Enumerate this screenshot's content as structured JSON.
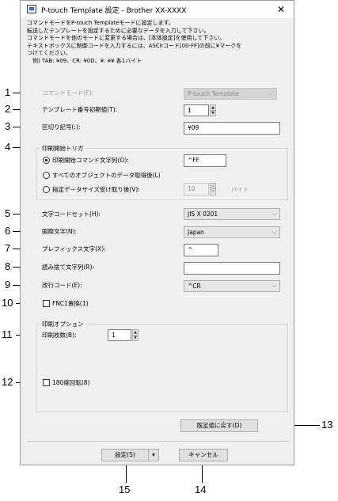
{
  "window": {
    "title": "P-touch Template 設定 - Brother XX-XXXX",
    "close_icon": "close-icon",
    "app_icon": "app-icon"
  },
  "info_lines": [
    "コマンドモードをP-touch Templateモードに設定します。",
    "転送したテンプレートを設定するために必要なデータを入力して下さい。",
    "コマンドモードを他のモードに変更する場合は、[本体設定]を使用して下さい。",
    "テキストボックスに制御コードを入力するには、ASCIIコード[00-FF]の前に¥マークを",
    "つけてください。",
    "　例) TAB: ¥09、CR: ¥0D、¥: ¥¥  各1バイト"
  ],
  "fields": {
    "command_mode_label": "コマンドモード(F):",
    "command_mode_value": "P-touch Template",
    "template_init_label": "テンプレート番号初期値(T):",
    "template_init_value": "1",
    "delimiter_label": "区切り記号(:):",
    "delimiter_value": "¥09",
    "trigger_group_title": "印刷開始トリガ",
    "trigger_cmd_label": "印刷開始コマンド文字列(O):",
    "trigger_cmd_value": "^FF",
    "trigger_all_label": "すべてのオブジェクトのデータ取得後(L)",
    "trigger_size_label": "指定データサイズ受け取り後(V):",
    "trigger_size_value": "10",
    "trigger_size_unit": "バイト",
    "charset_label": "文字コードセット(H):",
    "charset_value": "JIS X 0201",
    "intl_label": "国際文字(N):",
    "intl_value": "Japan",
    "prefix_label": "プレフィックス文字(X):",
    "prefix_value": "^",
    "skip_label": "読み捨て文字列(R):",
    "skip_value": "",
    "newline_label": "改行コード(E):",
    "newline_value": "^CR",
    "fnc1_label": "FNC1置換(1)",
    "print_opt_title": "印刷オプション",
    "copies_label": "印刷枚数(B):",
    "copies_value": "1",
    "rotate_label": "180度回転(8)"
  },
  "buttons": {
    "defaults": "既定値に戻す(D)",
    "settings": "設定(S)",
    "settings_arrow": "▾",
    "cancel": "キャンセル"
  },
  "callouts": [
    "1",
    "2",
    "3",
    "4",
    "5",
    "6",
    "7",
    "8",
    "9",
    "10",
    "11",
    "12",
    "13",
    "14",
    "15"
  ],
  "glyphs": {
    "chevron": "⌵",
    "close": "✕",
    "up": "▲",
    "down": "▼"
  }
}
